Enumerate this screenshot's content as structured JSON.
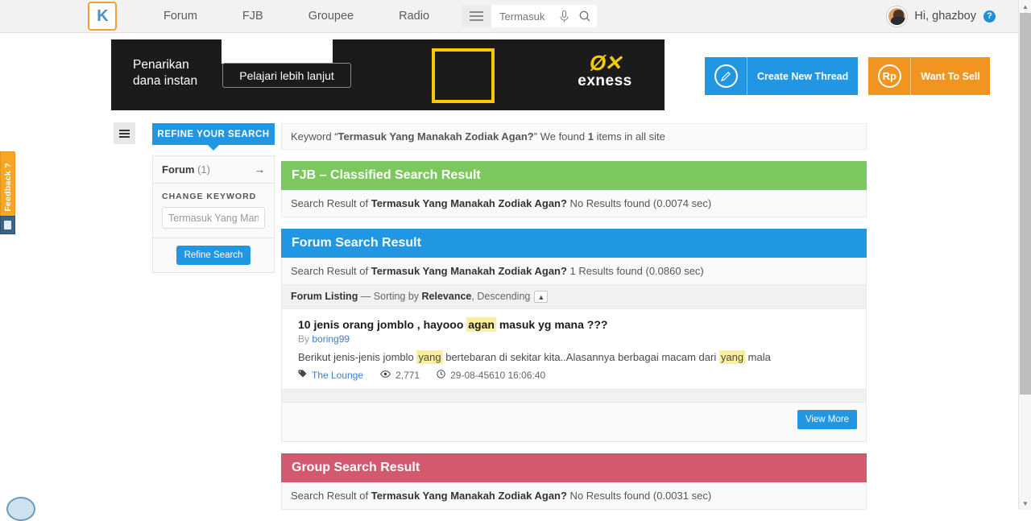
{
  "topnav": {
    "logo_alt": "K",
    "links": [
      "Forum",
      "FJB",
      "Groupee",
      "Radio"
    ],
    "search": {
      "placeholder": "Termasuk",
      "value": ""
    },
    "greeting": "Hi, ghazboy",
    "help_char": "?"
  },
  "banner": {
    "headline_line1": "Penarikan",
    "headline_line2": "dana instan",
    "cta": "Pelajari lebih lanjut",
    "brand_mark": "Ø✕",
    "brand_name": "exness"
  },
  "actions": {
    "create_thread": "Create New Thread",
    "create_thread_icon": "pencil-icon",
    "want_to_sell": "Want To Sell",
    "want_to_sell_icon": "Rp"
  },
  "sidebar": {
    "header": "REFINE YOUR SEARCH",
    "facet_name": "Forum",
    "facet_count": "(1)",
    "facet_arrow": "→",
    "change_keyword_label": "CHANGE KEYWORD",
    "keyword_input_value": "Termasuk Yang Manakah Zodiak Agan?",
    "refine_button": "Refine Search"
  },
  "results": {
    "keyword_prefix": "Keyword “",
    "keyword_term": "Termasuk Yang Manakah Zodiak Agan?",
    "keyword_suffix_a": "” We found ",
    "keyword_count": "1",
    "keyword_suffix_b": " items in all site",
    "fjb": {
      "title": "FJB – Classified Search Result",
      "prefix": "Search Result of ",
      "term": "Termasuk Yang Manakah Zodiak Agan?",
      "status": " No Results found (0.0074 sec)"
    },
    "forum": {
      "title": "Forum Search Result",
      "prefix": "Search Result of ",
      "term": "Termasuk Yang Manakah Zodiak Agan?",
      "status": " 1 Results found (0.0860 sec)",
      "listing_label": "Forum Listing",
      "listing_sep": " — Sorting by ",
      "listing_sort": "Relevance",
      "listing_dir": ", Descending",
      "sort_toggle_icon": "chevron-up-icon",
      "item": {
        "title_a": "10 jenis orang jomblo , hayooo ",
        "title_hl": "agan",
        "title_b": " masuk yg mana ???",
        "by_prefix": "By ",
        "author": "boring99",
        "snippet_a": "Berikut jenis-jenis jomblo ",
        "snippet_hl1": "yang",
        "snippet_b": " bertebaran di sekitar kita..Alasannya berbagai macam dari ",
        "snippet_hl2": "yang",
        "snippet_c": " mala",
        "tag_icon": "tag-icon",
        "tag": "The Lounge",
        "views_icon": "eye-icon",
        "views": "2,771",
        "time_icon": "clock-icon",
        "time": "29-08-45610 16:06:40"
      },
      "view_more": "View More"
    },
    "group": {
      "title": "Group Search Result",
      "prefix": "Search Result of ",
      "term": "Termasuk Yang Manakah Zodiak Agan?",
      "status": " No Results found (0.0031 sec)"
    }
  },
  "feedback": {
    "label": "Feedback ?"
  },
  "scrollbar": {
    "up": "▲",
    "down": "▼"
  }
}
